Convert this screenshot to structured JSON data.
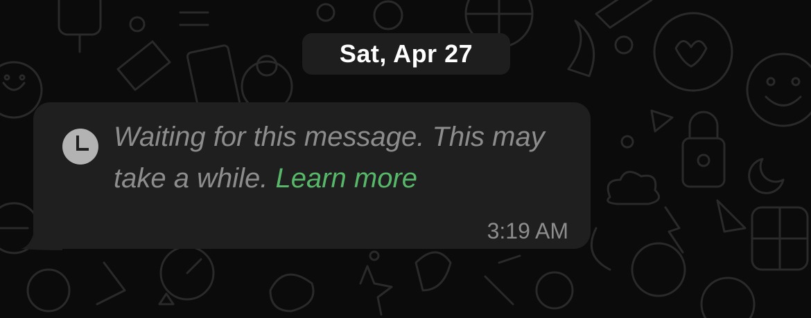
{
  "chat": {
    "date_separator": "Sat, Apr 27",
    "message": {
      "status_icon": "clock-icon",
      "text": "Waiting for this message. This may take a while.",
      "link_text": "Learn more",
      "time": "3:19 AM"
    }
  },
  "colors": {
    "background": "#0b0b0b",
    "bubble": "#1f1f1f",
    "date_pill": "#1e1e1e",
    "message_text": "#8d8d8d",
    "link": "#57b86a"
  }
}
